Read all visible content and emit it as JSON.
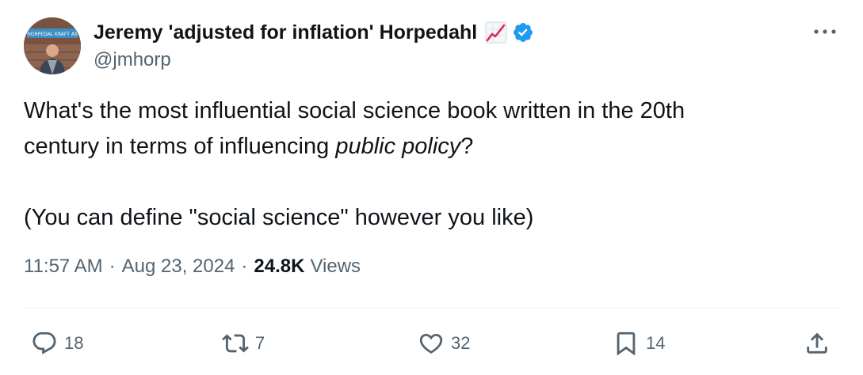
{
  "author": {
    "display_name": "Jeremy 'adjusted for inflation' Horpedahl",
    "handle": "@jmhorp",
    "avatar_sign_text": "HORPEDAL KRAFT AS",
    "name_emoji": "chart-increasing-icon",
    "verified": true
  },
  "tweet": {
    "text_line1": "What's the most influential social science book written in the 20th",
    "text_line2_prefix": "century in terms of influencing ",
    "text_line2_emphasis": "public policy",
    "text_line2_suffix": "?",
    "text_line4": "(You can define \"social science\" however you like)"
  },
  "meta": {
    "time": "11:57 AM",
    "separator": "·",
    "date": "Aug 23, 2024",
    "views_count": "24.8K",
    "views_label": "Views"
  },
  "actions": {
    "replies": "18",
    "reposts": "7",
    "likes": "32",
    "bookmarks": "14"
  },
  "colors": {
    "text_primary": "#0f1419",
    "text_secondary": "#536471",
    "verified_blue": "#1d9bf0",
    "divider": "#eff3f4"
  }
}
